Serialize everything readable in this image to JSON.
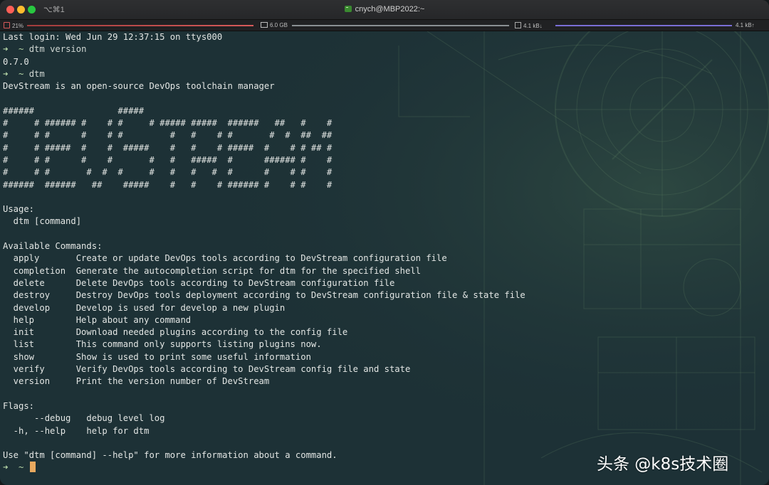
{
  "window": {
    "title": "cnych@MBP2022:~",
    "shortcut": "⌥⌘1"
  },
  "statusbar": {
    "cpu": "21%",
    "memory": "6.0 GB",
    "net_down": "4.1 kB↓",
    "net_up": "4.1 kB↑"
  },
  "terminal": {
    "lines": [
      {
        "type": "text",
        "text": "Last login: Wed Jun 29 12:37:15 on ttys000"
      },
      {
        "type": "prompt",
        "arrow": "➜",
        "dir": "~",
        "cmd": "dtm version"
      },
      {
        "type": "text",
        "text": "0.7.0"
      },
      {
        "type": "prompt",
        "arrow": "➜",
        "dir": "~",
        "cmd": "dtm"
      },
      {
        "type": "text",
        "text": "DevStream is an open-source DevOps toolchain manager"
      },
      {
        "type": "text",
        "text": ""
      },
      {
        "type": "text",
        "text": "######                #####"
      },
      {
        "type": "text",
        "text": "#     # ###### #    # #     # ##### #####  ######   ##   #    #"
      },
      {
        "type": "text",
        "text": "#     # #      #    # #         #   #    # #       #  #  ##  ##"
      },
      {
        "type": "text",
        "text": "#     # #####  #    #  #####    #   #    # #####  #    # # ## #"
      },
      {
        "type": "text",
        "text": "#     # #      #    #       #   #   #####  #      ###### #    #"
      },
      {
        "type": "text",
        "text": "#     # #       #  #  #     #   #   #   #  #      #    # #    #"
      },
      {
        "type": "text",
        "text": "######  ######   ##    #####    #   #    # ###### #    # #    #"
      },
      {
        "type": "text",
        "text": ""
      },
      {
        "type": "text",
        "text": "Usage:"
      },
      {
        "type": "text",
        "text": "  dtm [command]"
      },
      {
        "type": "text",
        "text": ""
      },
      {
        "type": "text",
        "text": "Available Commands:"
      },
      {
        "type": "text",
        "text": "  apply       Create or update DevOps tools according to DevStream configuration file"
      },
      {
        "type": "text",
        "text": "  completion  Generate the autocompletion script for dtm for the specified shell"
      },
      {
        "type": "text",
        "text": "  delete      Delete DevOps tools according to DevStream configuration file"
      },
      {
        "type": "text",
        "text": "  destroy     Destroy DevOps tools deployment according to DevStream configuration file & state file"
      },
      {
        "type": "text",
        "text": "  develop     Develop is used for develop a new plugin"
      },
      {
        "type": "text",
        "text": "  help        Help about any command"
      },
      {
        "type": "text",
        "text": "  init        Download needed plugins according to the config file"
      },
      {
        "type": "text",
        "text": "  list        This command only supports listing plugins now."
      },
      {
        "type": "text",
        "text": "  show        Show is used to print some useful information"
      },
      {
        "type": "text",
        "text": "  verify      Verify DevOps tools according to DevStream config file and state"
      },
      {
        "type": "text",
        "text": "  version     Print the version number of DevStream"
      },
      {
        "type": "text",
        "text": ""
      },
      {
        "type": "text",
        "text": "Flags:"
      },
      {
        "type": "text",
        "text": "      --debug   debug level log"
      },
      {
        "type": "text",
        "text": "  -h, --help    help for dtm"
      },
      {
        "type": "text",
        "text": ""
      },
      {
        "type": "text",
        "text": "Use \"dtm [command] --help\" for more information about a command."
      },
      {
        "type": "prompt",
        "arrow": "➜",
        "dir": "~",
        "cmd": "",
        "cursor": true
      }
    ]
  },
  "watermark": "头条 @k8s技术圈",
  "colors": {
    "background": "#1d3136",
    "text": "#e3e6e4",
    "cursor": "#e9a95f",
    "cpu_bar": "#d75a5a",
    "net_up_bar": "#7a6fd6"
  }
}
